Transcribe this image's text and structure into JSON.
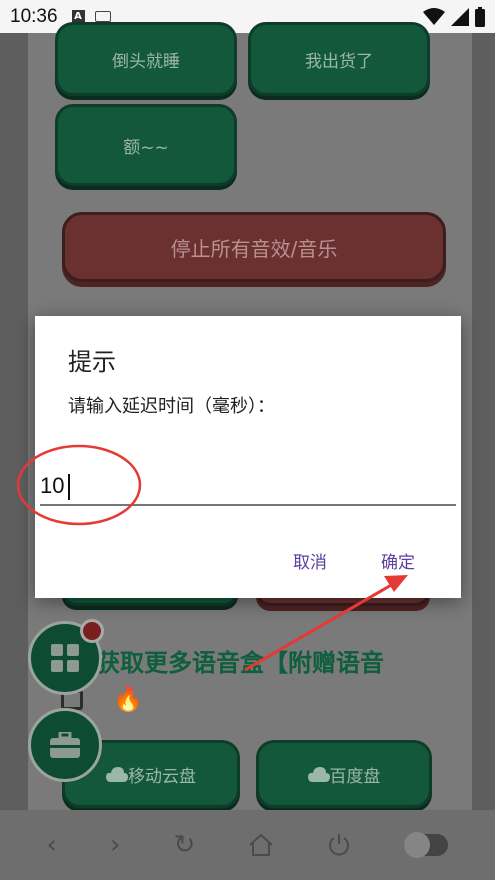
{
  "status_bar": {
    "time": "10:36",
    "a_badge": "A",
    "icons": [
      "wifi-icon",
      "signal-icon",
      "battery-icon"
    ]
  },
  "sound_buttons": [
    {
      "label": "倒头就睡"
    },
    {
      "label": "我出货了"
    },
    {
      "label": "额~~"
    }
  ],
  "stop_button": {
    "label": "停止所有音效/音乐"
  },
  "promo": {
    "text": "获取更多语音盒【附赠语音",
    "fire_emoji": "🔥"
  },
  "cloud_links": [
    {
      "label": "移动云盘",
      "icon": "cloud-icon"
    },
    {
      "label": "百度盘",
      "icon": "cloud-icon"
    }
  ],
  "fabs": [
    {
      "icon": "grid-icon",
      "has_badge": true
    },
    {
      "icon": "toolbox-icon"
    }
  ],
  "nav_bar": {
    "icons": [
      "back-icon",
      "forward-icon",
      "refresh-icon",
      "home-icon",
      "power-icon",
      "toggle-switch"
    ]
  },
  "dialog": {
    "title": "提示",
    "message": "请输入延迟时间（毫秒）：",
    "input_value": "10",
    "cancel_label": "取消",
    "confirm_label": "确定"
  },
  "colors": {
    "accent_purple": "#5b3f9b",
    "annotation_red": "#e53935",
    "button_green": "#14583c",
    "stop_red": "#6b3131"
  }
}
